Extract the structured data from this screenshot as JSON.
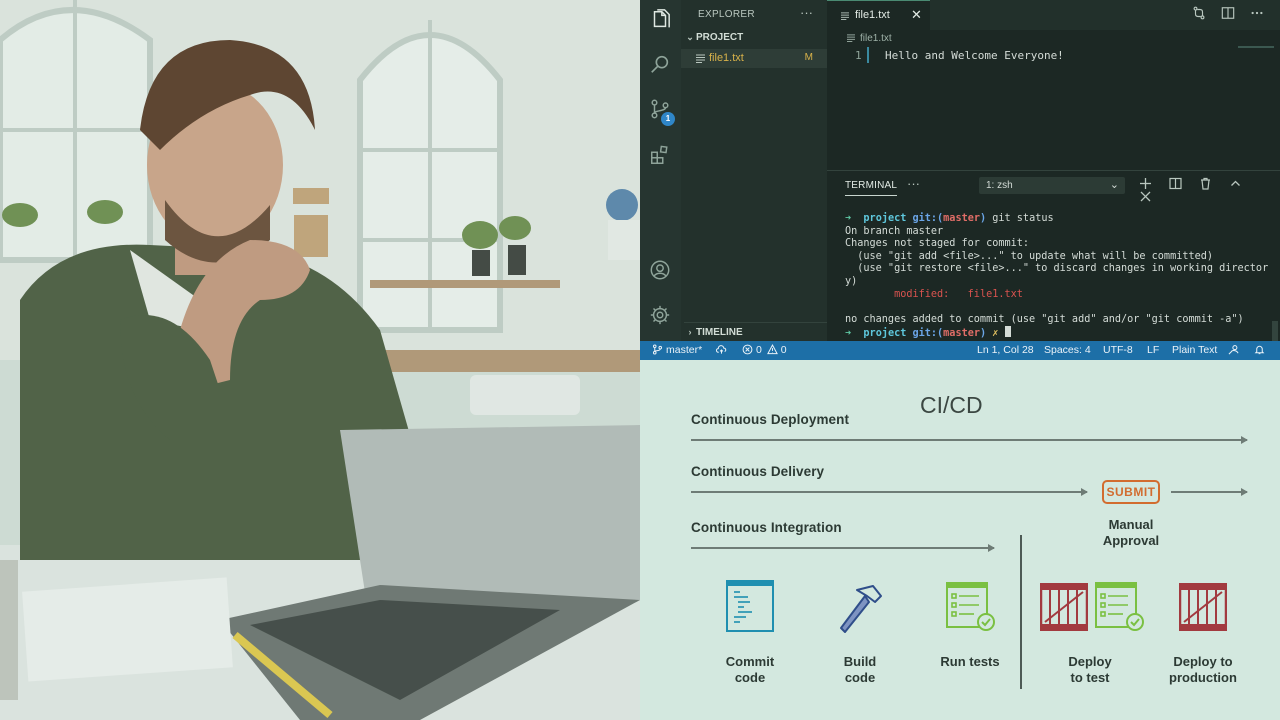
{
  "vscode": {
    "activity_badge": "1",
    "explorer": {
      "title": "EXPLORER",
      "more": "···",
      "project_section": "PROJECT",
      "file": {
        "name": "file1.txt",
        "status": "M"
      },
      "timeline_section": "TIMELINE"
    },
    "editor": {
      "tab_label": "file1.txt",
      "tab_close": "✕",
      "breadcrumb": "file1.txt",
      "line_number": "1",
      "line_text": "Hello and Welcome Everyone!"
    },
    "panel": {
      "title": "TERMINAL",
      "more": "···",
      "shell_select": "1: zsh",
      "terminal": {
        "prompt_arrow": "➜",
        "prompt_dir": "project",
        "prompt_git": "git:(",
        "prompt_branch": "master",
        "prompt_close": ")",
        "command": "git status",
        "line_branch": "On branch master",
        "line_changes": "Changes not staged for commit:",
        "line_hint1": "  (use \"git add <file>...\" to update what will be committed)",
        "line_hint2": "  (use \"git restore <file>...\" to discard changes in working director",
        "line_hint2_wrap": "y)",
        "modified_label": "        modified:   ",
        "modified_file": "file1.txt",
        "line_no_changes": "no changes added to commit (use \"git add\" and/or \"git commit -a\")",
        "dirty_mark": "✗"
      }
    },
    "statusbar": {
      "branch": "master*",
      "errors": "0",
      "warnings": "0",
      "position": "Ln 1, Col 28",
      "spaces": "Spaces: 4",
      "encoding": "UTF-8",
      "eol": "LF",
      "language": "Plain Text"
    }
  },
  "cicd": {
    "title": "CI/CD",
    "lanes": {
      "deployment": "Continuous Deployment",
      "delivery": "Continuous Delivery",
      "integration": "Continuous Integration"
    },
    "submit": "SUBMIT",
    "approval_line1": "Manual",
    "approval_line2": "Approval",
    "steps": {
      "commit": [
        "Commit",
        "code"
      ],
      "build": [
        "Build",
        "code"
      ],
      "tests": [
        "Run tests",
        ""
      ],
      "deploy_test": [
        "Deploy",
        "to test"
      ],
      "deploy_prod": [
        "Deploy to",
        "production"
      ]
    },
    "colors": {
      "background": "#d3e8df",
      "submit": "#d26c2f",
      "crate": "#a23a3f",
      "checklist": "#7ac042",
      "code_doc": "#1f8fb0",
      "hammer": "#2f4e8a"
    }
  }
}
